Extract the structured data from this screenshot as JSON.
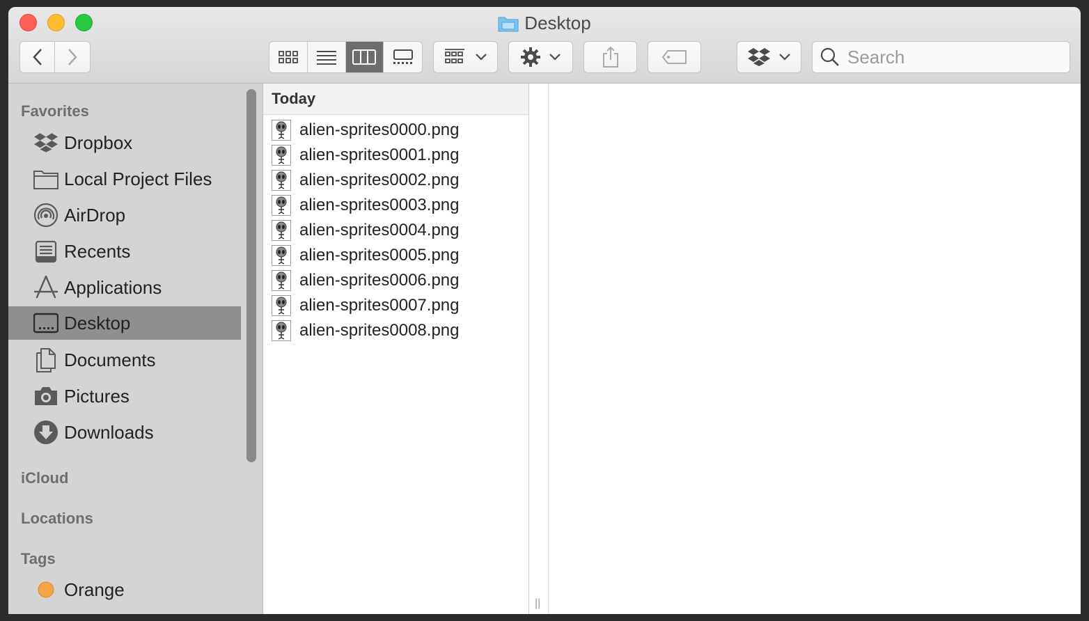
{
  "window": {
    "title": "Desktop"
  },
  "toolbar": {
    "back_icon": "chevron-left-icon",
    "forward_icon": "chevron-right-icon",
    "view_modes": [
      "icon-view",
      "list-view",
      "column-view",
      "gallery-view"
    ],
    "active_view": "column-view",
    "search_placeholder": "Search"
  },
  "sidebar": {
    "favorites_header": "Favorites",
    "favorites": [
      {
        "label": "Dropbox",
        "icon": "dropbox-icon"
      },
      {
        "label": "Local Project Files",
        "icon": "folder-icon"
      },
      {
        "label": "AirDrop",
        "icon": "airdrop-icon"
      },
      {
        "label": "Recents",
        "icon": "recents-icon"
      },
      {
        "label": "Applications",
        "icon": "applications-icon"
      },
      {
        "label": "Desktop",
        "icon": "desktop-icon",
        "selected": true
      },
      {
        "label": "Documents",
        "icon": "documents-icon"
      },
      {
        "label": "Pictures",
        "icon": "camera-icon"
      },
      {
        "label": "Downloads",
        "icon": "download-icon"
      }
    ],
    "icloud_header": "iCloud",
    "locations_header": "Locations",
    "tags_header": "Tags",
    "tags": [
      {
        "label": "Orange",
        "color": "#f5a445"
      }
    ]
  },
  "column": {
    "header": "Today",
    "files": [
      "alien-sprites0000.png",
      "alien-sprites0001.png",
      "alien-sprites0002.png",
      "alien-sprites0003.png",
      "alien-sprites0004.png",
      "alien-sprites0005.png",
      "alien-sprites0006.png",
      "alien-sprites0007.png",
      "alien-sprites0008.png"
    ]
  }
}
